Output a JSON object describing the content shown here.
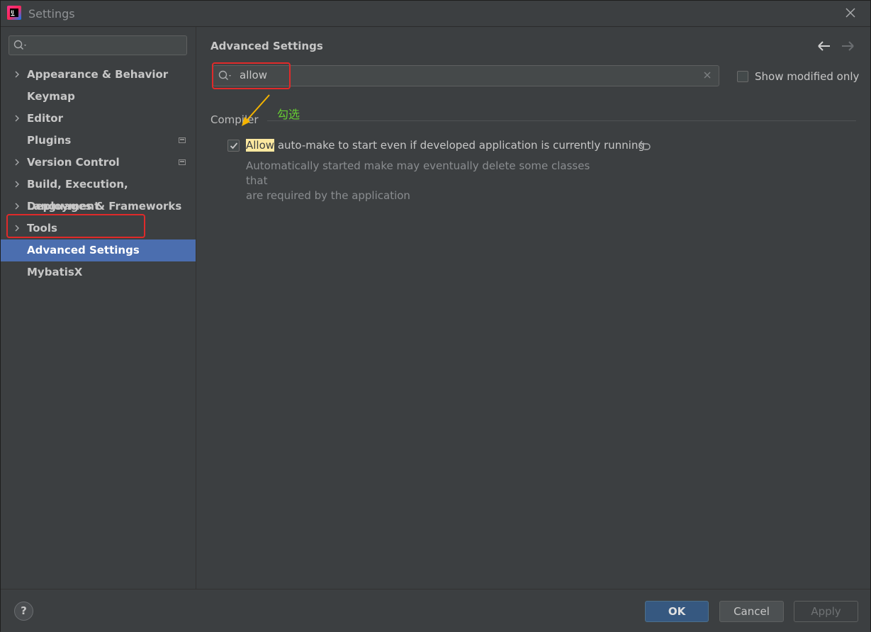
{
  "window": {
    "title": "Settings"
  },
  "sidebar": {
    "search": {
      "value": ""
    },
    "items": [
      {
        "label": "Appearance & Behavior",
        "expandable": true,
        "badge": false
      },
      {
        "label": "Keymap",
        "expandable": false,
        "badge": false
      },
      {
        "label": "Editor",
        "expandable": true,
        "badge": false
      },
      {
        "label": "Plugins",
        "expandable": false,
        "badge": true
      },
      {
        "label": "Version Control",
        "expandable": true,
        "badge": true
      },
      {
        "label": "Build, Execution, Deployment",
        "expandable": true,
        "badge": false
      },
      {
        "label": "Languages & Frameworks",
        "expandable": true,
        "badge": false
      },
      {
        "label": "Tools",
        "expandable": true,
        "badge": false
      },
      {
        "label": "Advanced Settings",
        "expandable": false,
        "badge": false,
        "selected": true
      },
      {
        "label": "MybatisX",
        "expandable": false,
        "badge": false
      }
    ]
  },
  "content": {
    "title": "Advanced Settings",
    "search": {
      "value": "allow"
    },
    "show_modified_only": {
      "label": "Show modified only",
      "checked": false
    },
    "section": "Compiler",
    "annotation": "勾选",
    "option": {
      "highlight": "Allow",
      "label_rest": " auto-make to start even if developed application is currently running",
      "checked": true,
      "description_line1": "Automatically started make may eventually delete some classes that",
      "description_line2": "are required by the application"
    }
  },
  "footer": {
    "help": "?",
    "ok": "OK",
    "cancel": "Cancel",
    "apply": "Apply"
  },
  "colors": {
    "background": "#3c3f41",
    "selection": "#4b6eaf",
    "annotation_box": "#e02a2a",
    "annotation_text": "#66cc33",
    "arrow": "#f5b400",
    "search_highlight": "#fce8a0"
  }
}
